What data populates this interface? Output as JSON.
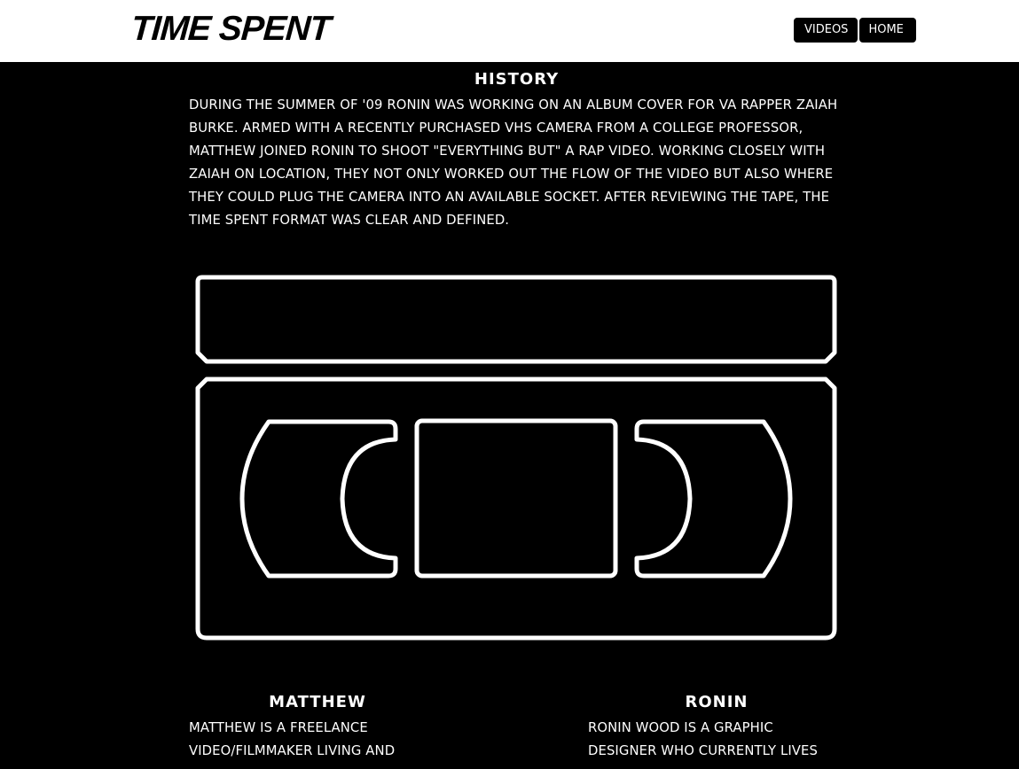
{
  "header": {
    "logo": "TIME SPENT",
    "nav": {
      "videos": "VIDEOS",
      "home": "HOME"
    }
  },
  "history": {
    "title": "HISTORY",
    "body": "DURING THE SUMMER OF '09 RONIN WAS WORKING ON AN ALBUM COVER FOR VA RAPPER ZAIAH BURKE. ARMED WITH A RECENTLY PURCHASED VHS CAMERA FROM A COLLEGE PROFESSOR, MATTHEW JOINED RONIN TO SHOOT \"EVERYTHING BUT\" A RAP VIDEO. WORKING CLOSELY WITH ZAIAH ON LOCATION, THEY NOT ONLY WORKED OUT THE FLOW OF THE VIDEO BUT ALSO WHERE THEY COULD PLUG THE CAMERA INTO AN AVAILABLE SOCKET. AFTER REVIEWING THE TAPE, THE TIME SPENT FORMAT WAS CLEAR AND DEFINED."
  },
  "illustration": {
    "icon": "vhs-cassette-icon"
  },
  "bios": {
    "matthew": {
      "name": "MATTHEW",
      "text": "MATTHEW IS A FREELANCE VIDEO/FILMMAKER LIVING AND"
    },
    "ronin": {
      "name": "RONIN",
      "text": "RONIN WOOD IS A GRAPHIC DESIGNER WHO CURRENTLY LIVES"
    }
  },
  "colors": {
    "background": "#000000",
    "header": "#ffffff",
    "text": "#ffffff",
    "nav_button": "#000000"
  }
}
